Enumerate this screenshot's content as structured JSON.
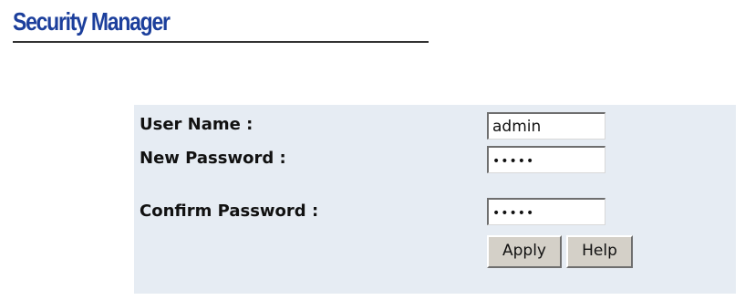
{
  "page": {
    "title": "Security Manager"
  },
  "form": {
    "user_name": {
      "label": "User Name :",
      "value": "admin"
    },
    "new_password": {
      "label": "New Password :",
      "value": "•••••"
    },
    "confirm_password": {
      "label": "Confirm Password :",
      "value": "•••••"
    },
    "apply_label": "Apply",
    "help_label": "Help"
  },
  "colors": {
    "title": "#1c3f9c",
    "panel_background": "#e6ecf3",
    "button_face": "#d4d0c8"
  }
}
